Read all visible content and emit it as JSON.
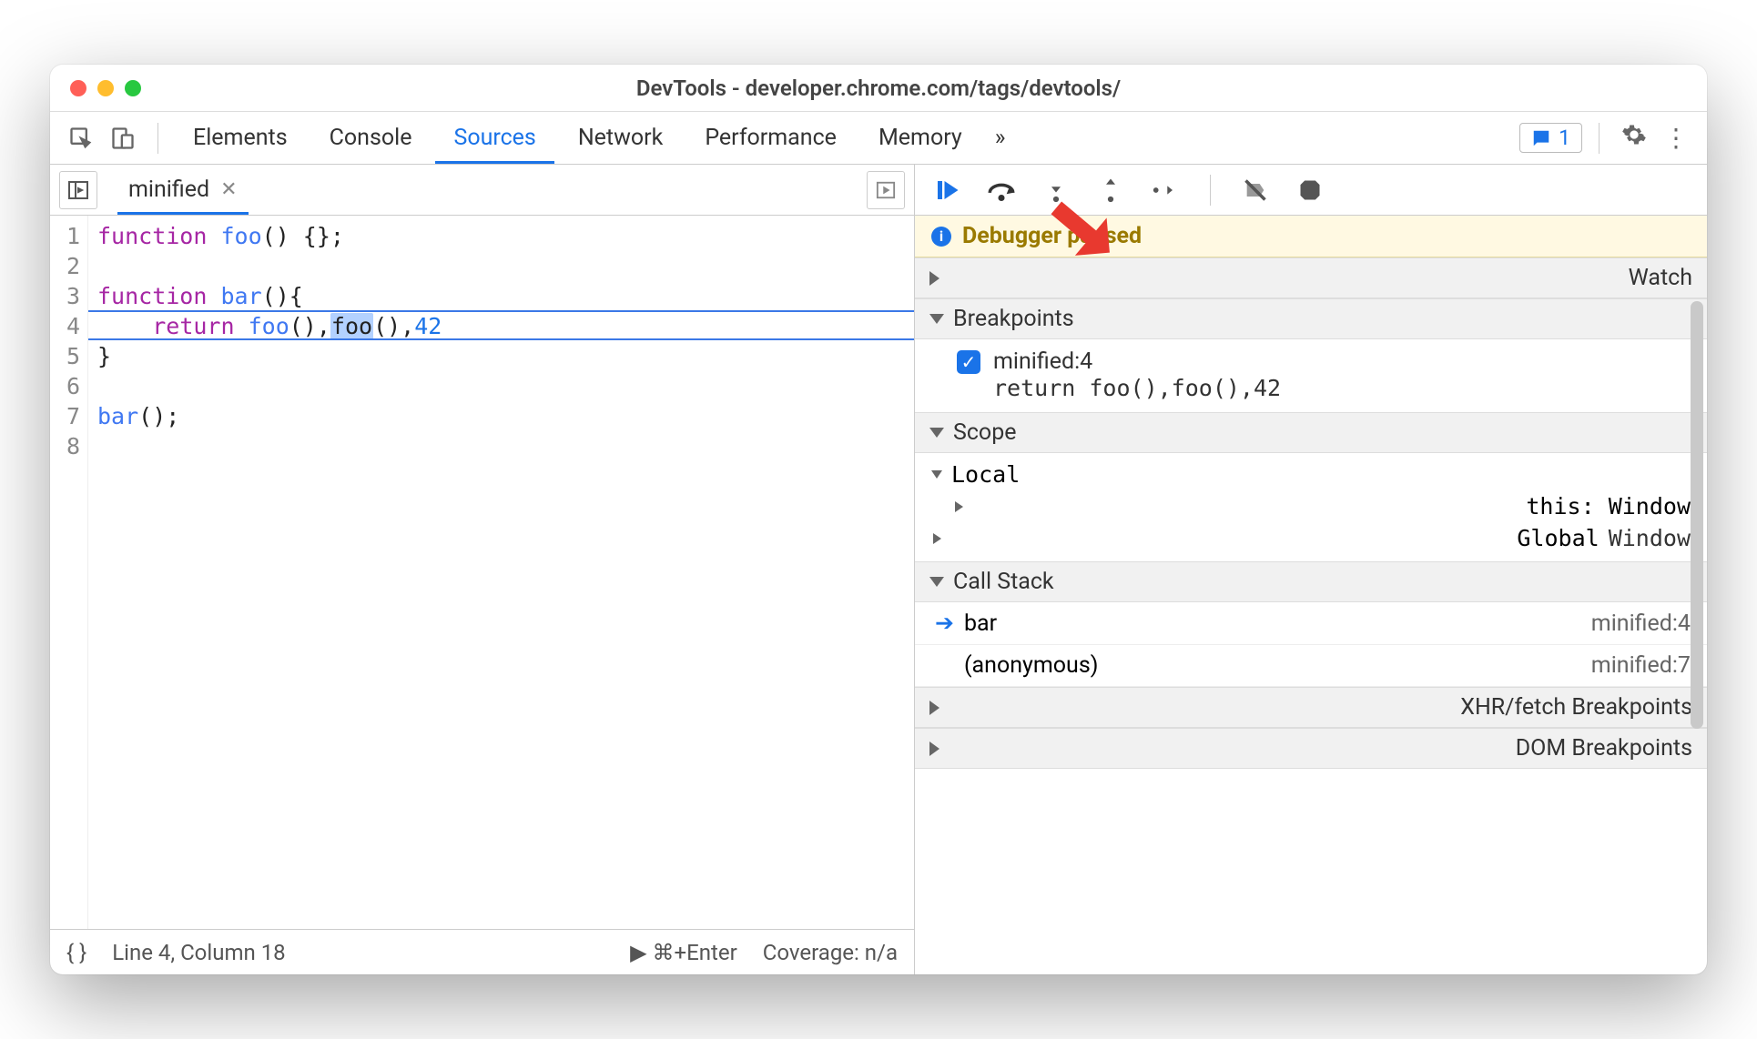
{
  "window_title": "DevTools - developer.chrome.com/tags/devtools/",
  "tabs": [
    "Elements",
    "Console",
    "Sources",
    "Network",
    "Performance",
    "Memory"
  ],
  "active_tab": "Sources",
  "overflow_glyph": "»",
  "error_count": "1",
  "file_tab": "minified",
  "code_lines": [
    {
      "n": "1",
      "html": "<span class='kw'>function</span> <span class='fn'>foo</span>() {};"
    },
    {
      "n": "2",
      "html": ""
    },
    {
      "n": "3",
      "html": "<span class='kw'>function</span> <span class='fn'>bar</span>(){"
    },
    {
      "n": "4",
      "html": "    <span class='ret'>return</span> <span class='fn'>foo</span>(),<span class='sel'>foo</span>(),<span class='num'>42</span>"
    },
    {
      "n": "5",
      "html": "}"
    },
    {
      "n": "6",
      "html": ""
    },
    {
      "n": "7",
      "html": "<span class='fn'>bar</span>();"
    },
    {
      "n": "8",
      "html": ""
    }
  ],
  "status": {
    "braces": "{ }",
    "pos": "Line 4, Column 18",
    "run": "▶ ⌘+Enter",
    "coverage": "Coverage: n/a"
  },
  "banner_text": "Debugger paused",
  "sections": {
    "watch": "Watch",
    "breakpoints": "Breakpoints",
    "scope": "Scope",
    "callstack": "Call Stack",
    "xhr": "XHR/fetch Breakpoints",
    "dom": "DOM Breakpoints"
  },
  "breakpoint": {
    "label": "minified:4",
    "code": "return foo(),foo(),42"
  },
  "scope": {
    "local": "Local",
    "this_label": "this",
    "this_value": "Window",
    "global": "Global",
    "global_value": "Window"
  },
  "callstack": [
    {
      "fn": "bar",
      "loc": "minified:4",
      "current": true
    },
    {
      "fn": "(anonymous)",
      "loc": "minified:7",
      "current": false
    }
  ]
}
